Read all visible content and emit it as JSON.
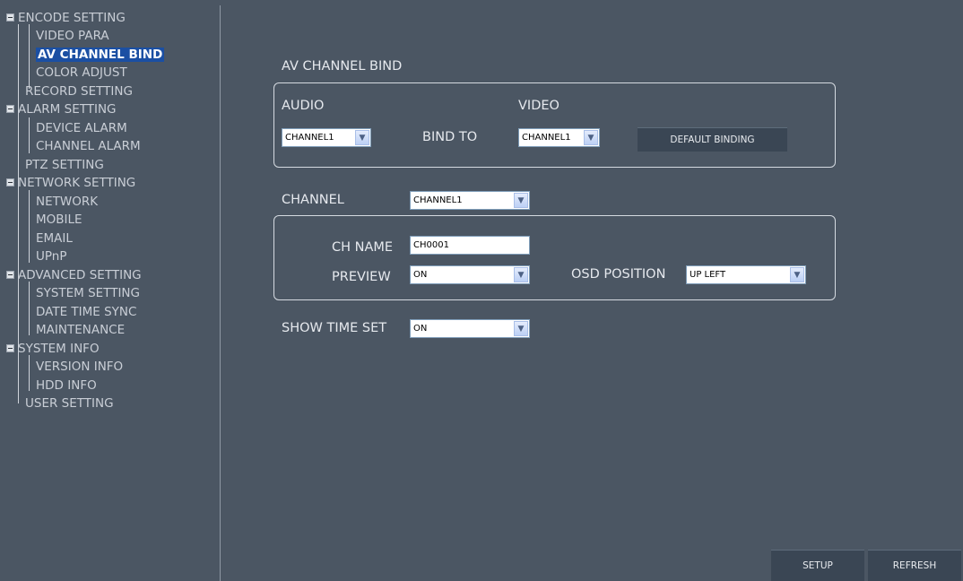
{
  "sidebar": {
    "items": [
      {
        "label": "ENCODE SETTING"
      },
      {
        "label": "VIDEO PARA"
      },
      {
        "label": "AV CHANNEL BIND"
      },
      {
        "label": "COLOR ADJUST"
      },
      {
        "label": "RECORD SETTING"
      },
      {
        "label": "ALARM SETTING"
      },
      {
        "label": "DEVICE ALARM"
      },
      {
        "label": "CHANNEL ALARM"
      },
      {
        "label": "PTZ SETTING"
      },
      {
        "label": "NETWORK SETTING"
      },
      {
        "label": "NETWORK"
      },
      {
        "label": "MOBILE"
      },
      {
        "label": "EMAIL"
      },
      {
        "label": "UPnP"
      },
      {
        "label": "ADVANCED SETTING"
      },
      {
        "label": "SYSTEM SETTING"
      },
      {
        "label": "DATE TIME SYNC"
      },
      {
        "label": "MAINTENANCE"
      },
      {
        "label": "SYSTEM INFO"
      },
      {
        "label": "VERSION INFO"
      },
      {
        "label": "HDD INFO"
      },
      {
        "label": "USER SETTING"
      }
    ],
    "selected": "AV CHANNEL BIND"
  },
  "main": {
    "section_title": "AV CHANNEL BIND",
    "bind_group": {
      "audio_label": "AUDIO",
      "video_label": "VIDEO",
      "bind_to_label": "BIND TO",
      "audio_select": "CHANNEL1",
      "video_select": "CHANNEL1",
      "default_button": "DEFAULT BINDING"
    },
    "channel_label": "CHANNEL",
    "channel_select": "CHANNEL1",
    "channel_group": {
      "ch_name_label": "CH NAME",
      "ch_name_value": "CH0001",
      "preview_label": "PREVIEW",
      "preview_select": "ON",
      "osd_label": "OSD POSITION",
      "osd_select": "UP LEFT"
    },
    "show_time_label": "SHOW TIME SET",
    "show_time_select": "ON"
  },
  "footer": {
    "setup_button": "SETUP",
    "refresh_button": "REFRESH"
  },
  "colors": {
    "background": "#4b5663",
    "selection": "#1b4fa3",
    "button": "#3a4654"
  },
  "icons": {
    "expander": "minus-box-icon",
    "dropdown": "chevron-down-icon"
  }
}
